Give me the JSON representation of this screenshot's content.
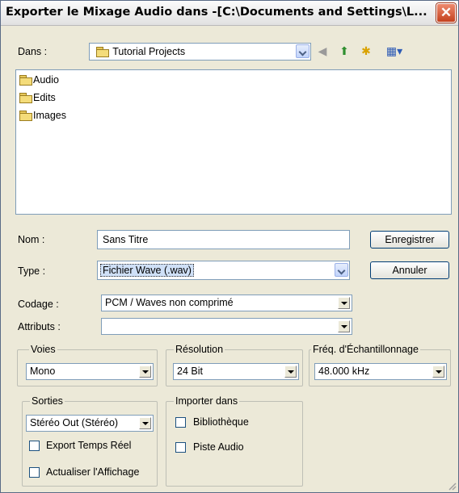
{
  "window": {
    "title": "Exporter le Mixage Audio dans -[C:\\Documents and Settings\\L...",
    "close_glyph": "✕"
  },
  "look_in": {
    "label": "Dans :",
    "value": "Tutorial Projects"
  },
  "toolbar": {
    "back_icon": "back-arrow-icon",
    "up_icon": "up-folder-icon",
    "new_folder_icon": "new-folder-icon",
    "view_menu_icon": "view-menu-icon",
    "back_glyph": "◀",
    "up_glyph": "⬆",
    "new_folder_glyph": "✱",
    "view_glyph": "▦▾"
  },
  "files": [
    "Audio",
    "Edits",
    "Images"
  ],
  "form": {
    "name_label": "Nom :",
    "name_value": "Sans Titre",
    "type_label": "Type :",
    "type_value": "Fichier Wave (.wav)",
    "coding_label": "Codage :",
    "coding_value": "PCM / Waves non comprimé",
    "attributes_label": "Attributs :",
    "attributes_value": ""
  },
  "buttons": {
    "save": "Enregistrer",
    "cancel": "Annuler"
  },
  "channels": {
    "label": "Voies",
    "value": "Mono"
  },
  "resolution": {
    "label": "Résolution",
    "value": "24 Bit"
  },
  "sample_rate": {
    "label": "Fréq. d'Échantillonnage",
    "value": "48.000 kHz"
  },
  "outputs": {
    "label": "Sorties",
    "value": "Stéréo Out (Stéréo)",
    "realtime_label": "Export Temps Réel",
    "refresh_label": "Actualiser l'Affichage"
  },
  "import_into": {
    "label": "Importer dans",
    "library_label": "Bibliothèque",
    "audio_track_label": "Piste Audio"
  }
}
